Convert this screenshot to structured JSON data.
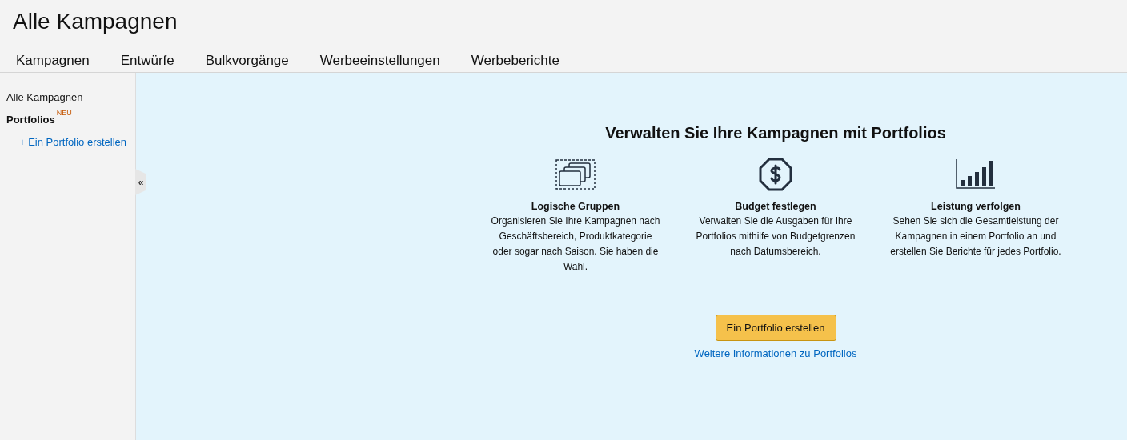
{
  "page_title": "Alle Kampagnen",
  "tabs": [
    {
      "label": "Kampagnen",
      "selected": false
    },
    {
      "label": "Entwürfe",
      "selected": false
    },
    {
      "label": "Bulkvorgänge",
      "selected": false
    },
    {
      "label": "Werbeeinstellungen",
      "selected": false
    },
    {
      "label": "Werbeberichte",
      "selected": false
    }
  ],
  "sidebar": {
    "items": [
      {
        "kind": "plain",
        "label": "Alle Kampagnen"
      },
      {
        "kind": "heading",
        "label": "Portfolios",
        "badge": "NEU"
      },
      {
        "kind": "link",
        "label": "+ Ein Portfolio erstellen"
      }
    ],
    "collapse": "«"
  },
  "promo": {
    "heading": "Verwalten Sie Ihre Kampagnen mit Portfolios",
    "features": [
      {
        "kind": "groups",
        "title": "Logische Gruppen",
        "text": "Organisieren Sie Ihre Kampagnen nach Geschäftsbereich, Produktkategorie oder sogar nach Saison. Sie haben die Wahl."
      },
      {
        "kind": "budget",
        "title": "Budget festlegen",
        "text": "Verwalten Sie die Ausgaben für Ihre Portfolios mithilfe von Budgetgrenzen nach Datumsbereich."
      },
      {
        "kind": "performance",
        "title": "Leistung verfolgen",
        "text": "Sehen Sie sich die Gesamtleistung der Kampagnen in einem Portfolio an und erstellen Sie Berichte für jedes Portfolio."
      }
    ],
    "button": "Ein Portfolio erstellen",
    "link": "Weitere Informationen zu Portfolios"
  }
}
